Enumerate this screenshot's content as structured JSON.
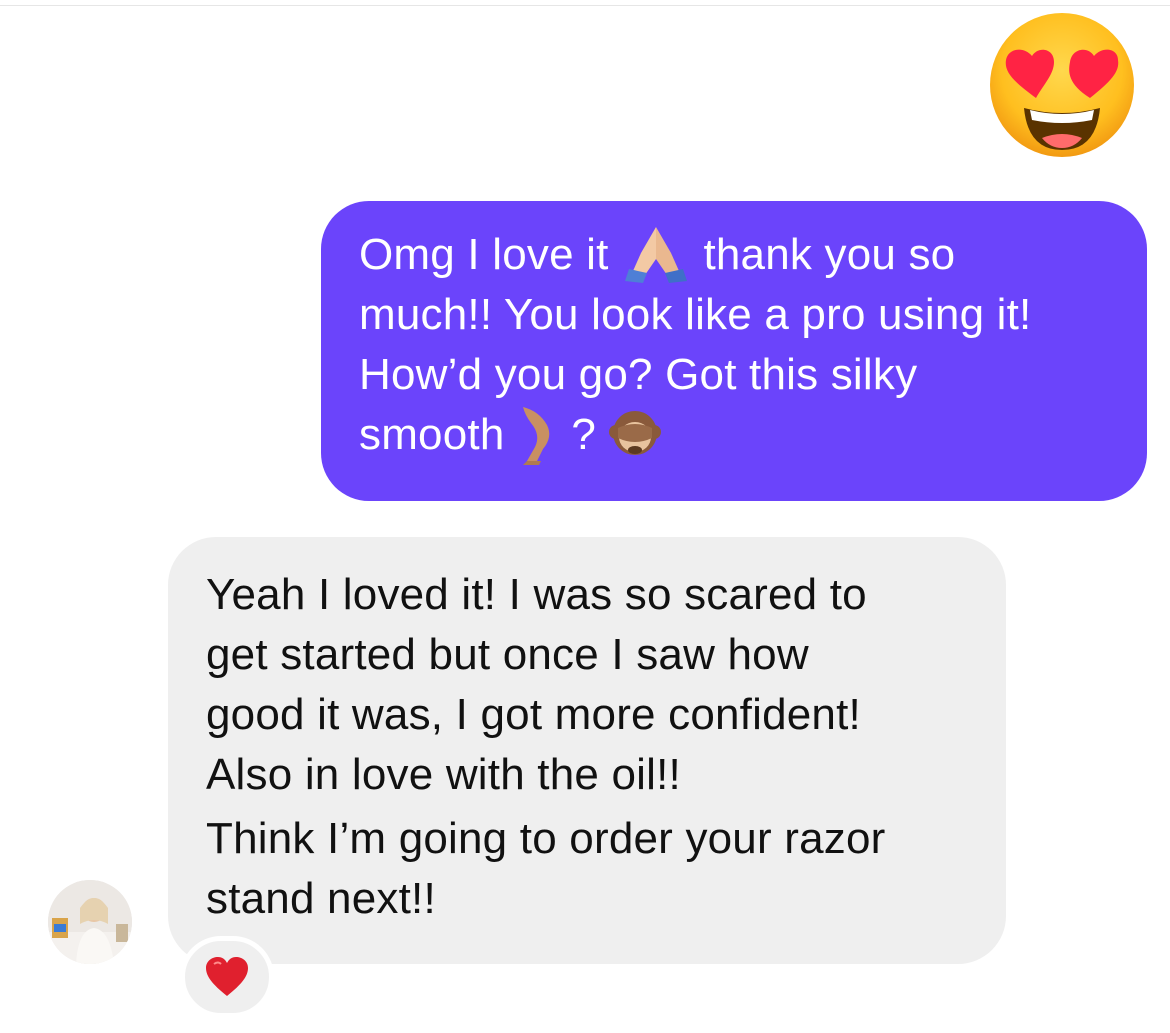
{
  "header": {
    "reaction_emoji_icon": "heart-eyes-emoji"
  },
  "messages": [
    {
      "sender": "me",
      "lines": [
        {
          "before": "Omg I love it ",
          "emoji": "folded-hands-emoji",
          "after": "thank you so"
        },
        {
          "text": "much!! You look like a pro using it!"
        },
        {
          "text": "How’d you go? Got this silky"
        },
        {
          "before": "smooth ",
          "emoji": "leg-emoji",
          "mid": " ? ",
          "emoji2": "see-no-evil-monkey-emoji"
        }
      ]
    },
    {
      "sender": "them",
      "paragraphs": [
        [
          "Yeah I loved it! I was so scared to",
          "get started but once I saw how",
          "good it was, I got more confident!",
          "Also in love with the oil!!"
        ],
        [
          "Think I’m going to order your razor",
          "stand next!!"
        ]
      ],
      "reaction": "red-heart-emoji"
    }
  ],
  "colors": {
    "sent_bubble": "#6b44fb",
    "received_bubble": "#efefef",
    "heart": "#e0202e"
  }
}
